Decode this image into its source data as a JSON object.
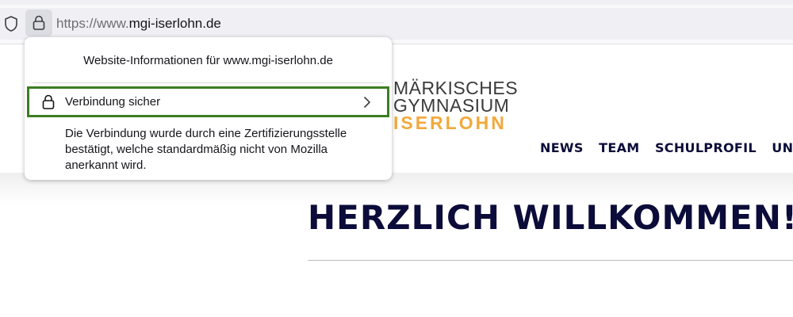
{
  "browser": {
    "url_protocol": "https://www.",
    "url_domain": "mgi-iserlohn.de"
  },
  "site": {
    "logo_lines": [
      "MÄRKISCHES",
      "GYMNASIUM",
      "ISERLOHN"
    ],
    "nav_items": [
      "NEWS",
      "TEAM",
      "SCHULPROFIL",
      "UNTI"
    ],
    "welcome_heading": "HERZLICH WILLKOMMEN!"
  },
  "site_info_popup": {
    "title": "Website-Informationen für www.mgi-iserlohn.de",
    "connection_label": "Verbindung sicher",
    "description": "Die Verbindung wurde durch eine Zertifizierungsstelle bestätigt, welche standardmäßig nicht von Mozilla anerkannt wird."
  },
  "colors": {
    "highlight_border": "#3b7d22",
    "logo_accent": "#f2a93b",
    "heading": "#0c0c3a"
  }
}
